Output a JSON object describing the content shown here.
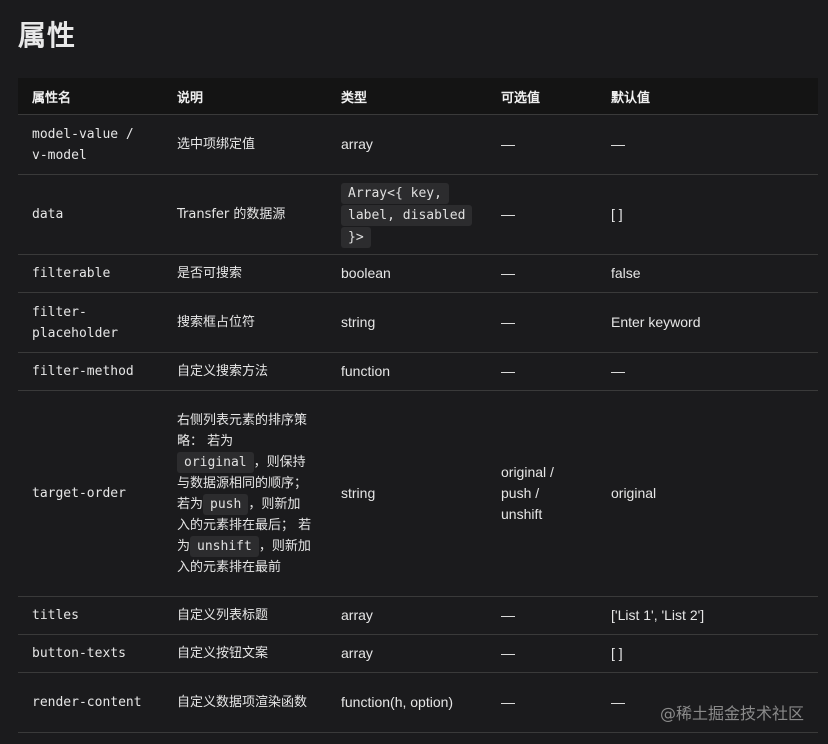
{
  "page": {
    "title": "属性"
  },
  "table": {
    "headers": [
      "属性名",
      "说明",
      "类型",
      "可选值",
      "默认值"
    ],
    "rows": [
      {
        "name": "model-value / v-model",
        "desc": "选中项绑定值",
        "type": "array",
        "options": "—",
        "default": "—"
      },
      {
        "name": "data",
        "desc": "Transfer 的数据源",
        "type_code": "Array<{ key, label, disabled }>",
        "options": "—",
        "default": "[ ]"
      },
      {
        "name": "filterable",
        "desc": "是否可搜索",
        "type": "boolean",
        "options": "—",
        "default": "false"
      },
      {
        "name": "filter-placeholder",
        "desc": "搜索框占位符",
        "type": "string",
        "options": "—",
        "default": "Enter keyword"
      },
      {
        "name": "filter-method",
        "desc": "自定义搜索方法",
        "type": "function",
        "options": "—",
        "default": "—"
      },
      {
        "name": "target-order",
        "desc_parts": {
          "p1": "右侧列表元素的排序策略： 若为",
          "c1": "original",
          "p2": "，则保持与数据源相同的顺序； 若为",
          "c2": "push",
          "p3": "，则新加入的元素排在最后； 若为",
          "c3": "unshift",
          "p4": "，则新加入的元素排在最前"
        },
        "type": "string",
        "options": "original / push / unshift",
        "default": "original"
      },
      {
        "name": "titles",
        "desc": "自定义列表标题",
        "type": "array",
        "options": "—",
        "default": "['List 1', 'List 2']"
      },
      {
        "name": "button-texts",
        "desc": "自定义按钮文案",
        "type": "array",
        "options": "—",
        "default": "[ ]"
      },
      {
        "name": "render-content",
        "desc": "自定义数据项渲染函数",
        "type": "function(h, option)",
        "options": "—",
        "default": "—"
      }
    ]
  },
  "watermark": "@稀土掘金技术社区"
}
